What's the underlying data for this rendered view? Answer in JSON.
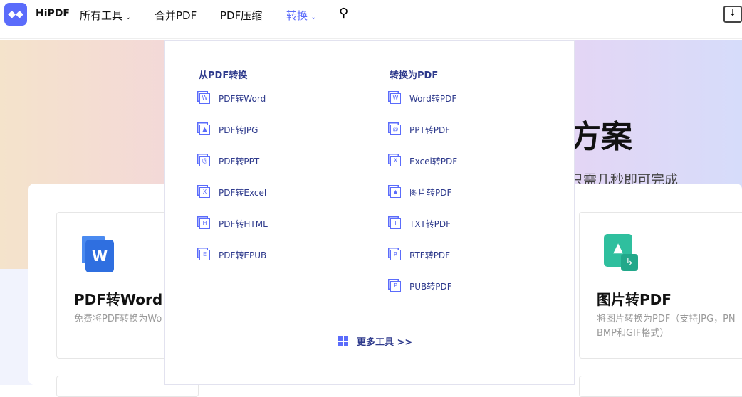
{
  "nav": {
    "brand": "HiPDF",
    "items": [
      {
        "label": "所有工具"
      },
      {
        "label": "合并PDF"
      },
      {
        "label": "PDF压缩"
      },
      {
        "label": "转换"
      }
    ],
    "accent": "#5b6cfb"
  },
  "hero": {
    "title": "方案",
    "subtitle": "只需几秒即可完成"
  },
  "cards": [
    {
      "title": "PDF转Word",
      "desc": "免费将PDF转换为Wo"
    },
    {
      "title": "图片转PDF",
      "desc1": "将图片转换为PDF（支持JPG，PN",
      "desc2": "BMP和GIF格式）"
    }
  ],
  "menu": {
    "from_heading": "从PDF转换",
    "to_heading": "转换为PDF",
    "from": [
      {
        "label": "PDF转Word",
        "icon": "W"
      },
      {
        "label": "PDF转JPG",
        "icon": "▲"
      },
      {
        "label": "PDF转PPT",
        "icon": "@"
      },
      {
        "label": "PDF转Excel",
        "icon": "X"
      },
      {
        "label": "PDF转HTML",
        "icon": "H"
      },
      {
        "label": "PDF转EPUB",
        "icon": "E"
      }
    ],
    "to": [
      {
        "label": "Word转PDF",
        "icon": "W"
      },
      {
        "label": "PPT转PDF",
        "icon": "@"
      },
      {
        "label": "Excel转PDF",
        "icon": "X"
      },
      {
        "label": "图片转PDF",
        "icon": "▲"
      },
      {
        "label": "TXT转PDF",
        "icon": "T"
      },
      {
        "label": "RTF转PDF",
        "icon": "R"
      },
      {
        "label": "PUB转PDF",
        "icon": "P"
      }
    ],
    "more": "更多工具 >>"
  }
}
